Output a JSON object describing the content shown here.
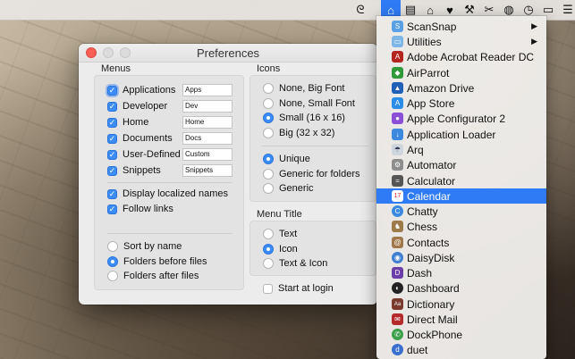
{
  "menubar": {
    "icons": [
      {
        "name": "swirl-icon",
        "glyph": "ᘓ"
      },
      {
        "name": "launcher-icon",
        "glyph": "⌂",
        "active": true
      },
      {
        "name": "clipboard-icon",
        "glyph": "▤"
      },
      {
        "name": "home-icon",
        "glyph": "⌂"
      },
      {
        "name": "heart-icon",
        "glyph": "♥"
      },
      {
        "name": "hammer-icon",
        "glyph": "⚒"
      },
      {
        "name": "scissors-icon",
        "glyph": "✂"
      },
      {
        "name": "globe-icon",
        "glyph": "◍"
      },
      {
        "name": "clock-icon",
        "glyph": "◷"
      },
      {
        "name": "inbox-icon",
        "glyph": "▭"
      },
      {
        "name": "list-icon",
        "glyph": "☰"
      }
    ]
  },
  "window": {
    "title": "Preferences",
    "menus": {
      "title": "Menus",
      "items": [
        {
          "label": "Applications",
          "field": "Apps",
          "checked": true
        },
        {
          "label": "Developer",
          "field": "Dev",
          "checked": true
        },
        {
          "label": "Home",
          "field": "Home",
          "checked": true
        },
        {
          "label": "Documents",
          "field": "Docs",
          "checked": true
        },
        {
          "label": "User-Defined",
          "field": "Custom",
          "checked": true
        },
        {
          "label": "Snippets",
          "field": "Snippets",
          "checked": true
        }
      ],
      "display_localized": "Display localized names",
      "follow_links": "Follow links",
      "sort_options": [
        "Sort by name",
        "Folders before files",
        "Folders after files"
      ]
    },
    "icons": {
      "title": "Icons",
      "size_options": [
        "None, Big Font",
        "None, Small Font",
        "Small (16 x 16)",
        "Big (32 x 32)"
      ],
      "style_options": [
        "Unique",
        "Generic for folders",
        "Generic"
      ]
    },
    "menu_title": {
      "title": "Menu Title",
      "options": [
        "Text",
        "Icon",
        "Text & Icon"
      ]
    },
    "start_at_login": "Start at login"
  },
  "menu": {
    "items": [
      {
        "label": "ScanSnap",
        "submenu": true,
        "color": "#5aa0e6",
        "glyph": "S"
      },
      {
        "label": "Utilities",
        "submenu": true,
        "color": "#7fb6e8",
        "glyph": "▭"
      },
      {
        "label": "Adobe Acrobat Reader DC",
        "color": "#b3261e",
        "glyph": "A"
      },
      {
        "label": "AirParrot",
        "color": "#2e9a3a",
        "glyph": "◆"
      },
      {
        "label": "Amazon Drive",
        "color": "#1f5fb8",
        "glyph": "▲"
      },
      {
        "label": "App Store",
        "color": "#2a8de8",
        "glyph": "A"
      },
      {
        "label": "Apple Configurator 2",
        "color": "#8a4fd6",
        "glyph": "●"
      },
      {
        "label": "Application Loader",
        "color": "#3b8ae0",
        "glyph": "↓"
      },
      {
        "label": "Arq",
        "color": "#cfd6dd",
        "glyph": "☂"
      },
      {
        "label": "Automator",
        "color": "#8e8e8e",
        "glyph": "⚙"
      },
      {
        "label": "Calculator",
        "color": "#555555",
        "glyph": "="
      },
      {
        "label": "Calendar",
        "color": "#e8e8e8",
        "glyph": "17",
        "selected": true
      },
      {
        "label": "Chatty",
        "color": "#3b8ae0",
        "glyph": "C"
      },
      {
        "label": "Chess",
        "color": "#9c7a4a",
        "glyph": "♞"
      },
      {
        "label": "Contacts",
        "color": "#a0784c",
        "glyph": "@"
      },
      {
        "label": "DaisyDisk",
        "color": "#3e7fd2",
        "glyph": "◉"
      },
      {
        "label": "Dash",
        "color": "#6b3ea8",
        "glyph": "D"
      },
      {
        "label": "Dashboard",
        "color": "#222222",
        "glyph": "◐"
      },
      {
        "label": "Dictionary",
        "color": "#7a3b2e",
        "glyph": "Aa"
      },
      {
        "label": "Direct Mail",
        "color": "#b52b2b",
        "glyph": "✉"
      },
      {
        "label": "DockPhone",
        "color": "#3aa04a",
        "glyph": "✆"
      },
      {
        "label": "duet",
        "color": "#3a6fd0",
        "glyph": "d"
      }
    ]
  }
}
